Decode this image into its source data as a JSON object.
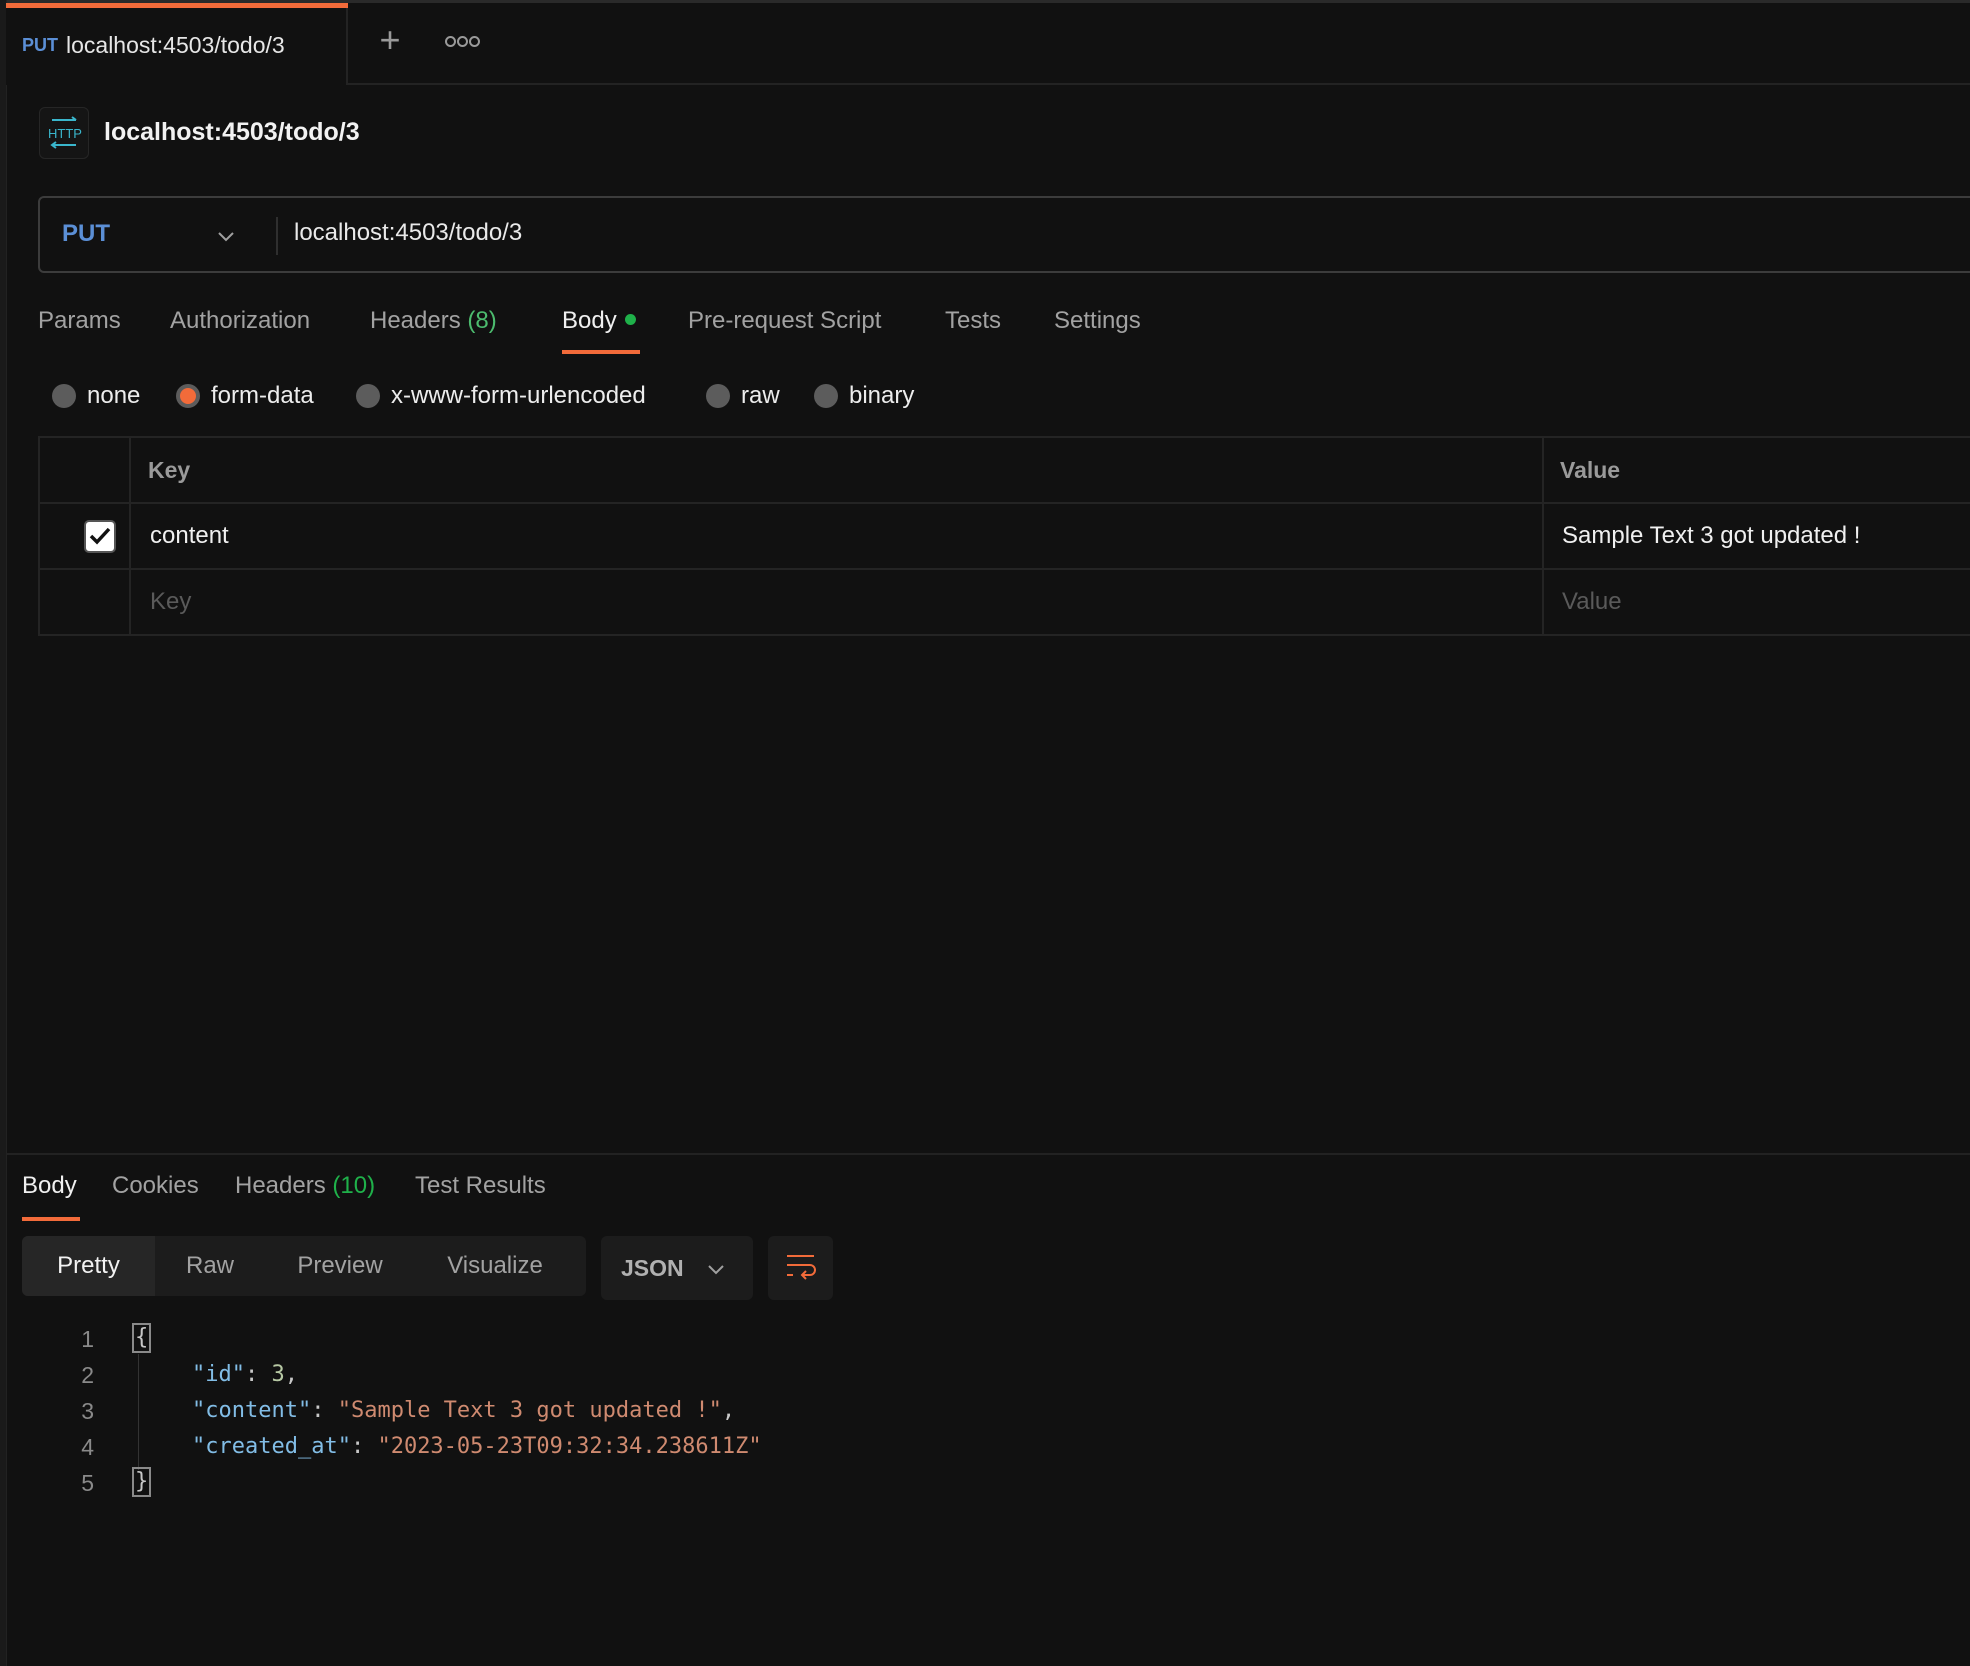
{
  "tab": {
    "method": "PUT",
    "title": "localhost:4503/todo/3"
  },
  "tabbar": {
    "new_tab": "+",
    "more": "more-options"
  },
  "request": {
    "name": "localhost:4503/todo/3",
    "icon_label": "HTTP",
    "method": "PUT",
    "url": "localhost:4503/todo/3"
  },
  "request_tabs": [
    {
      "label": "Params"
    },
    {
      "label": "Authorization"
    },
    {
      "label": "Headers",
      "count": "(8)"
    },
    {
      "label": "Body",
      "active": true,
      "indicator": "green-dot"
    },
    {
      "label": "Pre-request Script"
    },
    {
      "label": "Tests"
    },
    {
      "label": "Settings"
    }
  ],
  "body_types": [
    {
      "label": "none",
      "selected": false
    },
    {
      "label": "form-data",
      "selected": true
    },
    {
      "label": "x-www-form-urlencoded",
      "selected": false
    },
    {
      "label": "raw",
      "selected": false
    },
    {
      "label": "binary",
      "selected": false
    }
  ],
  "form_table": {
    "headers": {
      "key": "Key",
      "value": "Value"
    },
    "rows": [
      {
        "checked": true,
        "key": "content",
        "value": "Sample Text 3 got updated !"
      }
    ],
    "placeholder": {
      "key": "Key",
      "value": "Value"
    }
  },
  "response_tabs": [
    {
      "label": "Body",
      "active": true
    },
    {
      "label": "Cookies"
    },
    {
      "label": "Headers",
      "count": "(10)"
    },
    {
      "label": "Test Results"
    }
  ],
  "view_modes": [
    {
      "label": "Pretty",
      "active": true
    },
    {
      "label": "Raw"
    },
    {
      "label": "Preview"
    },
    {
      "label": "Visualize"
    }
  ],
  "format": "JSON",
  "response_body": {
    "line_numbers": [
      "1",
      "2",
      "3",
      "4",
      "5"
    ],
    "open_brace": "{",
    "close_brace": "}",
    "fields": [
      {
        "key": "\"id\"",
        "value": "3",
        "type": "number",
        "trail": ","
      },
      {
        "key": "\"content\"",
        "value": "\"Sample Text 3 got updated !\"",
        "type": "string",
        "trail": ","
      },
      {
        "key": "\"created_at\"",
        "value": "\"2023-05-23T09:32:34.238611Z\"",
        "type": "string",
        "trail": ""
      }
    ]
  },
  "colors": {
    "accent": "#f26b3a",
    "method": "#5b8fd6",
    "count_green": "#1fb14a",
    "json_key": "#82bde6",
    "json_string": "#cf8a70"
  }
}
